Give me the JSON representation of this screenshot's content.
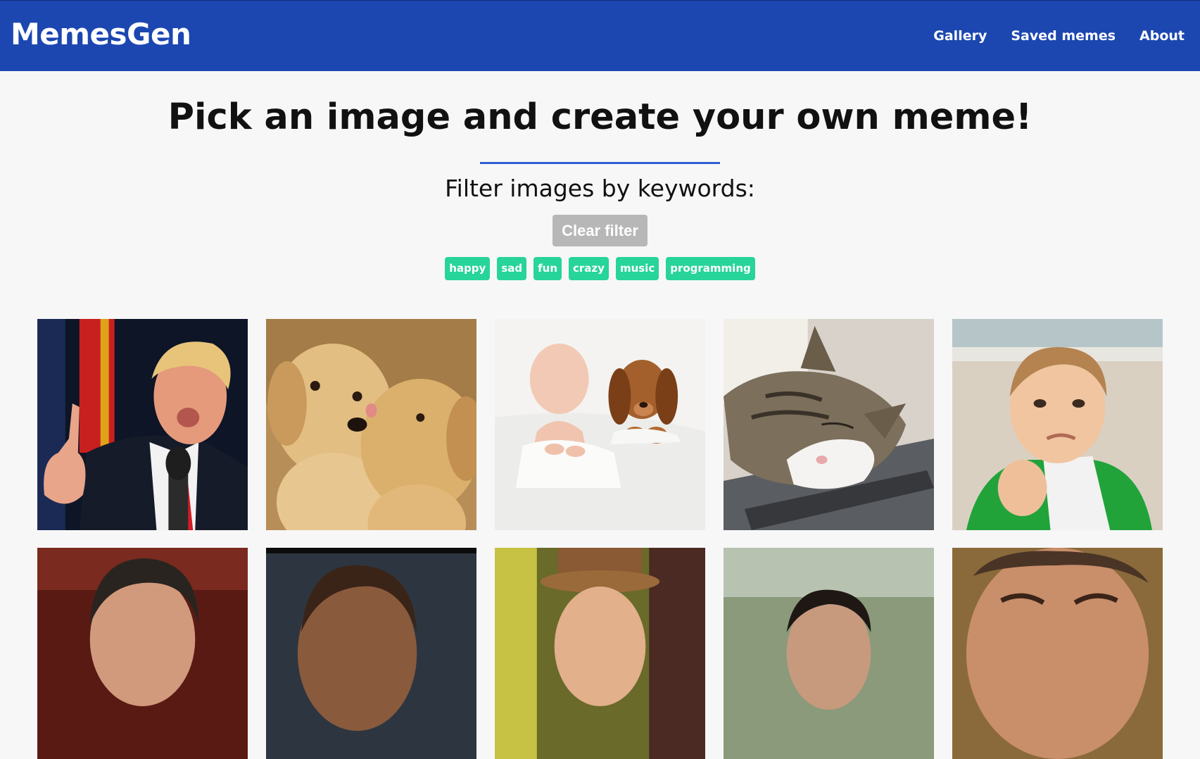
{
  "header": {
    "brand": "MemesGen",
    "nav": [
      {
        "label": "Gallery"
      },
      {
        "label": "Saved memes"
      },
      {
        "label": "About"
      }
    ]
  },
  "main": {
    "headline": "Pick an image and create your own meme!",
    "filter_label": "Filter images by keywords:",
    "clear_filter_label": "Clear filter",
    "keywords": [
      "happy",
      "sad",
      "fun",
      "crazy",
      "music",
      "programming"
    ]
  },
  "gallery": {
    "images": [
      {
        "subject": "politician-pointing"
      },
      {
        "subject": "puppies-kissing"
      },
      {
        "subject": "baby-and-puppy-sleeping"
      },
      {
        "subject": "cat-sleeping-on-laptop"
      },
      {
        "subject": "success-kid"
      },
      {
        "subject": "man-portrait"
      },
      {
        "subject": "child-portrait"
      },
      {
        "subject": "man-in-top-hat"
      },
      {
        "subject": "person-outdoors"
      },
      {
        "subject": "man-close-up"
      }
    ]
  },
  "colors": {
    "header_bg": "#1c47b1",
    "accent_line": "#2f5fd4",
    "tag_bg": "#27d49a",
    "clear_btn_bg": "#b7b7b7",
    "page_bg": "#f7f7f7"
  }
}
